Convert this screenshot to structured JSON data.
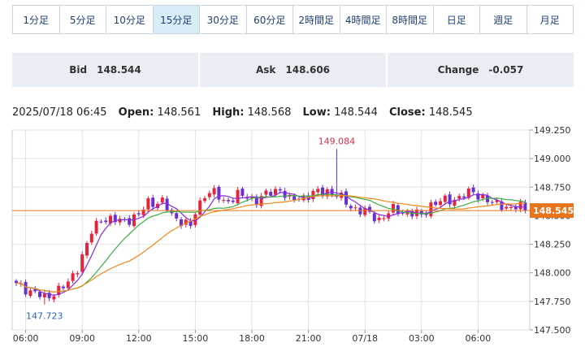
{
  "tabs": [
    {
      "label": "1分足",
      "active": false
    },
    {
      "label": "5分足",
      "active": false
    },
    {
      "label": "10分足",
      "active": false
    },
    {
      "label": "15分足",
      "active": true
    },
    {
      "label": "30分足",
      "active": false
    },
    {
      "label": "60分足",
      "active": false
    },
    {
      "label": "2時間足",
      "active": false
    },
    {
      "label": "4時間足",
      "active": false
    },
    {
      "label": "8時間足",
      "active": false
    },
    {
      "label": "日足",
      "active": false
    },
    {
      "label": "週足",
      "active": false
    },
    {
      "label": "月足",
      "active": false
    }
  ],
  "quotes": {
    "bid_label": "Bid",
    "bid": "148.544",
    "ask_label": "Ask",
    "ask": "148.606",
    "change_label": "Change",
    "change": "-0.057"
  },
  "ohlc": {
    "datetime": "2025/07/18 06:45",
    "open_label": "Open:",
    "open": "148.561",
    "high_label": "High:",
    "high": "148.568",
    "low_label": "Low:",
    "low": "148.544",
    "close_label": "Close:",
    "close": "148.545"
  },
  "colors": {
    "up": "#e8243c",
    "down": "#6a2fd3",
    "ma_short": "#8a2be2",
    "ma_mid": "#3cb043",
    "ma_long": "#f08a1c",
    "current": "#e8741c",
    "high_label": "#d1304a",
    "low_label": "#2a63b8",
    "grid": "#e2e2e2",
    "tab_text": "#1f3f73"
  },
  "chart_data": {
    "type": "candlestick",
    "ylim": [
      147.5,
      149.25
    ],
    "y_ticks": [
      "149.250",
      "149.000",
      "148.750",
      "148.500",
      "148.250",
      "148.000",
      "147.750",
      "147.500"
    ],
    "x_ticks": [
      "06:00",
      "09:00",
      "12:00",
      "15:00",
      "18:00",
      "21:00",
      "07/18",
      "03:00",
      "06:00"
    ],
    "current_price": "148.545",
    "max_label": "149.084",
    "min_label": "147.723",
    "waypoints": [
      [
        0,
        147.89
      ],
      [
        4,
        147.83
      ],
      [
        6,
        147.77
      ],
      [
        9,
        147.86
      ],
      [
        11,
        147.9
      ],
      [
        13,
        148.05
      ],
      [
        16,
        148.35
      ],
      [
        18,
        148.48
      ],
      [
        22,
        148.45
      ],
      [
        26,
        148.5
      ],
      [
        28,
        148.62
      ],
      [
        31,
        148.62
      ],
      [
        33,
        148.5
      ],
      [
        35,
        148.46
      ],
      [
        37,
        148.4
      ],
      [
        38,
        148.52
      ],
      [
        40,
        148.7
      ],
      [
        42,
        148.7
      ],
      [
        44,
        148.62
      ],
      [
        47,
        148.68
      ],
      [
        51,
        148.64
      ],
      [
        54,
        148.7
      ],
      [
        56,
        148.74
      ],
      [
        58,
        148.63
      ],
      [
        62,
        148.68
      ],
      [
        64,
        148.7
      ],
      [
        66,
        148.72
      ],
      [
        68,
        148.68
      ],
      [
        71,
        148.58
      ],
      [
        74,
        148.53
      ],
      [
        77,
        148.47
      ],
      [
        80,
        148.55
      ],
      [
        84,
        148.52
      ],
      [
        86,
        148.5
      ],
      [
        88,
        148.6
      ],
      [
        92,
        148.64
      ],
      [
        94,
        148.66
      ],
      [
        97,
        148.71
      ],
      [
        99,
        148.66
      ],
      [
        101,
        148.6
      ],
      [
        103,
        148.6
      ],
      [
        105,
        148.56
      ],
      [
        107,
        148.58
      ],
      [
        108,
        148.545
      ]
    ]
  }
}
